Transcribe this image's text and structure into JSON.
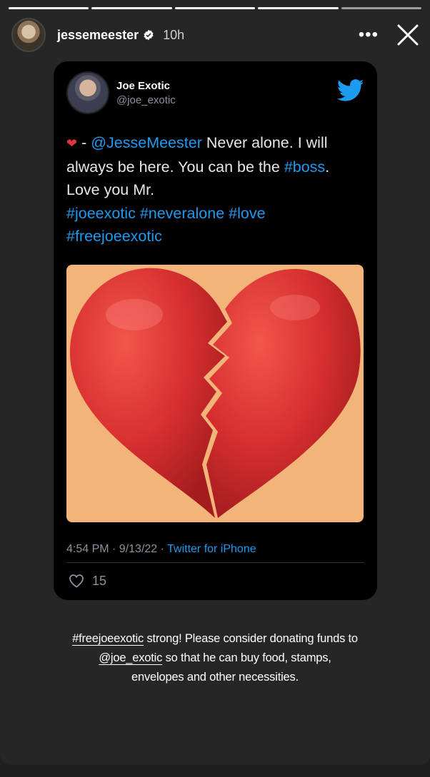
{
  "story": {
    "progress_segments": 5,
    "active_segment": 4,
    "username": "jessemeester",
    "time": "10h",
    "more_icon": "more-horizontal-icon",
    "close_icon": "close-icon"
  },
  "tweet": {
    "name": "Joe Exotic",
    "handle": "@joe_exotic",
    "text": {
      "dash": " - ",
      "mention": "@JesseMeester",
      "part1": " Never alone. I will always be here. You can be the ",
      "tag_boss": "#boss",
      "part2": ". Love you Mr. ",
      "tag1": "#joeexotic",
      "tag2": "#neveralone",
      "tag3": "#love",
      "tag4": "#freejoeexotic"
    },
    "meta_time": "4:54 PM · 9/13/22 · ",
    "meta_source": "Twitter for iPhone",
    "likes": "15",
    "image_subject": "broken-heart-icon"
  },
  "caption": {
    "tag": "#freejoeexotic",
    "part1": " strong! Please consider donating funds to ",
    "mention": "@joe_exotic",
    "part2": " so that he can buy food, stamps, envelopes and other necessities."
  },
  "colors": {
    "twitter_blue": "#1d9bf0",
    "image_background": "#f3b47a",
    "heart_red": "#d62f2f"
  }
}
